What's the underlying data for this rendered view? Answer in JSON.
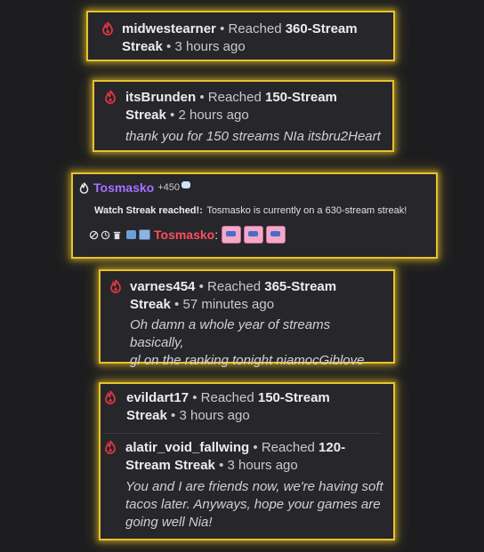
{
  "cards": [
    {
      "user": "midwestearner",
      "sep": "•",
      "reached": "Reached",
      "streak_line1": "360-Stream",
      "streak_line2": "Streak",
      "time": "3 hours ago",
      "message": ""
    },
    {
      "user": "itsBrunden",
      "sep": "•",
      "reached": "Reached",
      "streak_line1": "150-Stream",
      "streak_line2": "Streak",
      "time": "2 hours ago",
      "message": "thank you for 150 streams NIa itsbru2Heart"
    },
    {
      "user": "varnes454",
      "sep": "•",
      "reached": "Reached",
      "streak_line1": "365-Stream",
      "streak_line2": "Streak",
      "time": "57 minutes ago",
      "message_line1": "Oh damn a whole year of streams basically,",
      "message_line2": "gl on the ranking tonight niamocGiblove"
    },
    {
      "user": "evildart17",
      "sep": "•",
      "reached": "Reached",
      "streak_line1": "150-Stream",
      "streak_line2": "Streak",
      "time": "3 hours ago"
    },
    {
      "user": "alatir_void_fallwing",
      "sep": "•",
      "reached": "Reached",
      "streak_line1": "120-",
      "streak_line2": "Stream Streak",
      "time": "3 hours ago",
      "message_line1": "You and I are friends now, we're having soft",
      "message_line2": "tacos later. Anyways, hope your games are",
      "message_line3": "going well Nia!"
    }
  ],
  "watch_streak": {
    "user": "Tosmasko",
    "points": "+450",
    "title": "Watch Streak reached!:",
    "text": "Tosmasko is currently on a 630-stream streak!",
    "chat_user": "Tosmasko",
    "colon": ":"
  },
  "colors": {
    "border_gold": "#e8c22a",
    "card_bg": "#26262b",
    "page_bg": "#1d1d20",
    "flame_red": "#e0353f",
    "name_purple": "#a970ff",
    "chat_name_red": "#ff4f5e"
  },
  "icons": [
    "flame-icon",
    "channel-points-icon",
    "ban-icon",
    "timeout-icon",
    "delete-icon",
    "badge-icon",
    "emote-icon"
  ]
}
